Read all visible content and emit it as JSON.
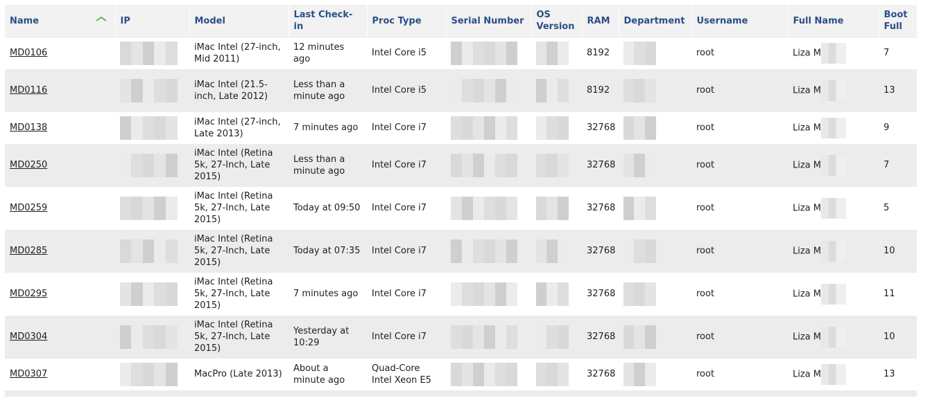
{
  "columns": {
    "name": "Name",
    "ip": "IP",
    "model": "Model",
    "last_checkin": "Last Check-in",
    "proc_type": "Proc Type",
    "serial": "Serial Number",
    "os_version": "OS Version",
    "ram": "RAM",
    "department": "Department",
    "username": "Username",
    "full_name": "Full Name",
    "boot_full": "Boot Full"
  },
  "sort": {
    "column": "name",
    "direction": "ascending",
    "icon": "chevron-up-icon",
    "color": "#33aa33"
  },
  "rows": [
    {
      "name": "MD0106",
      "model": "iMac Intel (27-inch, Mid 2011)",
      "last_checkin": "12 minutes ago",
      "proc_type": "Intel Core i5",
      "ram": "8192",
      "username": "root",
      "full_name": "Liza M",
      "boot_full": "7"
    },
    {
      "name": "MD0116",
      "model": "iMac Intel (21.5-inch, Late 2012)",
      "last_checkin": "Less than a minute ago",
      "proc_type": "Intel Core i5",
      "ram": "8192",
      "username": "root",
      "full_name": "Liza M",
      "boot_full": "13"
    },
    {
      "name": "MD0138",
      "model": "iMac Intel (27-inch, Late 2013)",
      "last_checkin": "7 minutes ago",
      "proc_type": "Intel Core i7",
      "ram": "32768",
      "username": "root",
      "full_name": "Liza M",
      "boot_full": "9"
    },
    {
      "name": "MD0250",
      "model": "iMac Intel (Retina 5k, 27-Inch, Late 2015)",
      "last_checkin": "Less than a minute ago",
      "proc_type": "Intel Core i7",
      "ram": "32768",
      "username": "root",
      "full_name": "Liza M",
      "boot_full": "7"
    },
    {
      "name": "MD0259",
      "model": "iMac Intel (Retina 5k, 27-Inch, Late 2015)",
      "last_checkin": "Today at 09:50",
      "proc_type": "Intel Core i7",
      "ram": "32768",
      "username": "root",
      "full_name": "Liza M",
      "boot_full": "5"
    },
    {
      "name": "MD0285",
      "model": "iMac Intel (Retina 5k, 27-Inch, Late 2015)",
      "last_checkin": "Today at 07:35",
      "proc_type": "Intel Core i7",
      "ram": "32768",
      "username": "root",
      "full_name": "Liza M",
      "boot_full": "10"
    },
    {
      "name": "MD0295",
      "model": "iMac Intel (Retina 5k, 27-Inch, Late 2015)",
      "last_checkin": "7 minutes ago",
      "proc_type": "Intel Core i7",
      "ram": "32768",
      "username": "root",
      "full_name": "Liza M",
      "boot_full": "11"
    },
    {
      "name": "MD0304",
      "model": "iMac Intel (Retina 5k, 27-Inch, Late 2015)",
      "last_checkin": "Yesterday at 10:29",
      "proc_type": "Intel Core i7",
      "ram": "32768",
      "username": "root",
      "full_name": "Liza M",
      "boot_full": "10"
    },
    {
      "name": "MD0307",
      "model": "MacPro (Late 2013)",
      "last_checkin": "About a minute ago",
      "proc_type": "Quad-Core Intel Xeon E5",
      "ram": "32768",
      "username": "root",
      "full_name": "Liza M",
      "boot_full": "13"
    }
  ]
}
